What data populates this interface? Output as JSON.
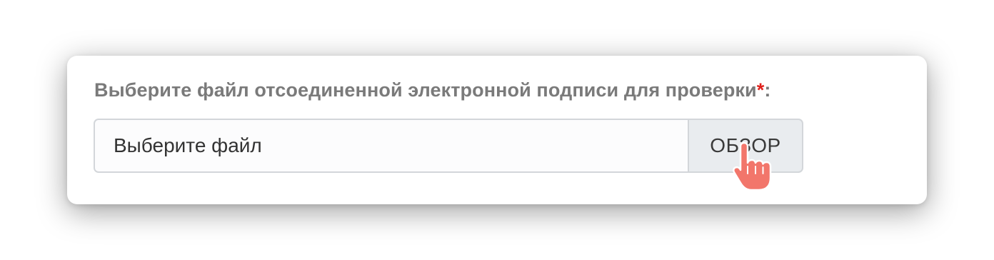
{
  "form": {
    "label_text": "Выберите файл отсоединенной электронной подписи для проверки",
    "required_mark": "*",
    "label_suffix": ":",
    "file_placeholder": "Выберите файл",
    "browse_label": "ОБЗОР"
  },
  "icons": {
    "cursor": "hand-pointer-icon"
  },
  "colors": {
    "label": "#7a7a7a",
    "required": "#e0201b",
    "button_bg": "#e9ecef",
    "border": "#d3d6da",
    "cursor_fill": "#f2766b"
  }
}
